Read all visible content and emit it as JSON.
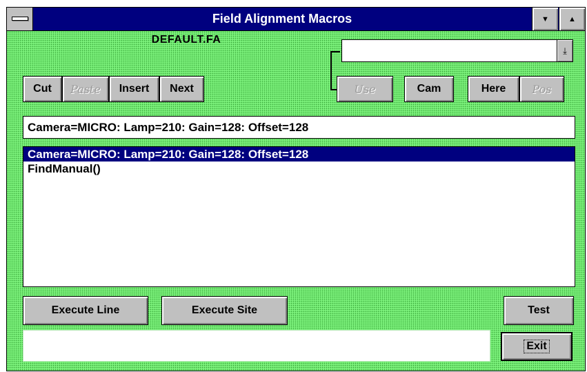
{
  "window": {
    "title": "Field Alignment Macros",
    "system_menu_icon": "system-menu-bar-icon",
    "minimize_glyph": "▼",
    "maximize_glyph": "▲"
  },
  "file": {
    "name": "DEFAULT.FA"
  },
  "combo": {
    "value": "",
    "dropdown_glyph": "⤓"
  },
  "toolbar": {
    "cut": "Cut",
    "paste": "Paste",
    "insert": "Insert",
    "next": "Next",
    "use": "Use",
    "cam": "Cam",
    "here": "Here",
    "pos": "Pos"
  },
  "edit_line": {
    "value": "Camera=MICRO: Lamp=210: Gain=128: Offset=128"
  },
  "macro_list": {
    "items": [
      "Camera=MICRO: Lamp=210: Gain=128: Offset=128",
      "FindManual()"
    ],
    "selected_index": 0
  },
  "actions": {
    "execute_line": "Execute Line",
    "execute_site": "Execute Site",
    "test": "Test",
    "exit": "Exit"
  },
  "status": {
    "text": ""
  },
  "colors": {
    "title_bar": "#00007f",
    "client_background": "#7cf27c",
    "selection": "#00007f",
    "button_face": "#c0c0c0"
  }
}
